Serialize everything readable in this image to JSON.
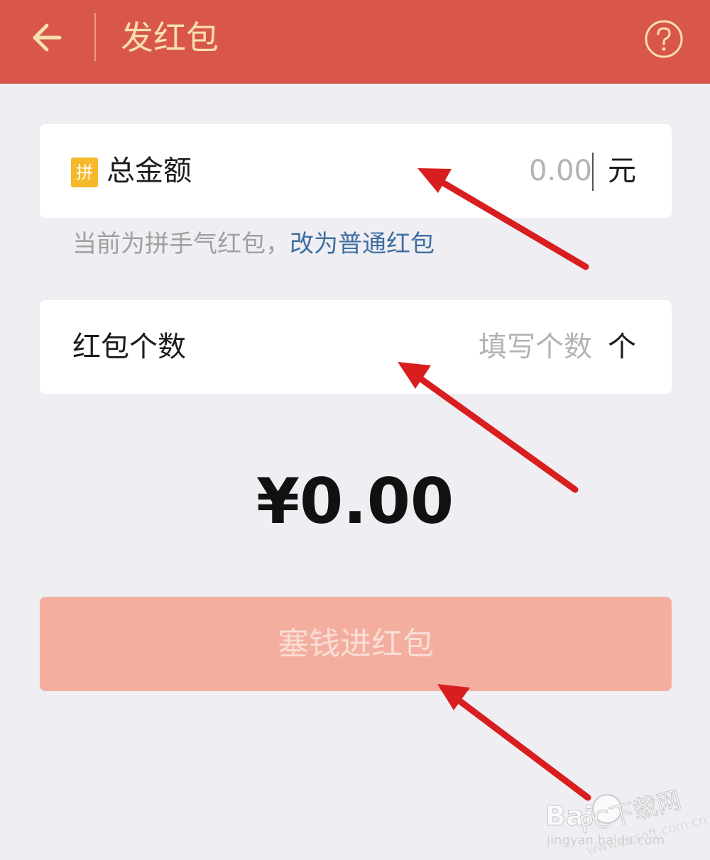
{
  "header": {
    "title": "发红包",
    "back_icon": "arrow-left-icon",
    "help_icon": "question-circle-icon",
    "bg_color": "#d9574a",
    "title_color": "#f8e0ac"
  },
  "amount_card": {
    "badge": "拼",
    "label": "总金额",
    "placeholder": "0.00",
    "unit": "元"
  },
  "hint": {
    "text": "当前为拼手气红包，",
    "link": "改为普通红包",
    "link_color": "#3f6ea2"
  },
  "count_card": {
    "label": "红包个数",
    "placeholder": "填写个数",
    "unit": "个"
  },
  "total": {
    "display": "¥0.00"
  },
  "submit": {
    "label": "塞钱进红包",
    "bg_color": "#f4aea0"
  },
  "annotation": {
    "arrow_color": "#d81e1e"
  },
  "watermark": {
    "text": "Baidu经验 jingyan.baidu.com PC下载网 www.pcsoft.com.cn"
  }
}
